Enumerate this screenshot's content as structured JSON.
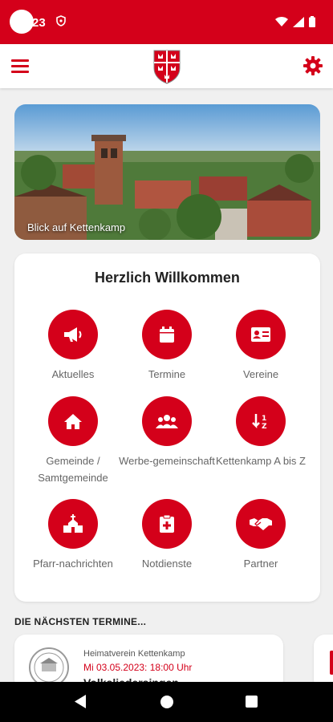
{
  "status_bar": {
    "time": "23",
    "shield_icon": "shield-icon",
    "icons": [
      "wifi-icon",
      "signal-icon",
      "battery-icon"
    ]
  },
  "app_bar": {
    "menu_icon": "menu-icon",
    "logo": "town-crest",
    "settings_icon": "gear-icon"
  },
  "hero": {
    "caption": "Blick auf Kettenkamp"
  },
  "welcome": {
    "title": "Herzlich Willkommen",
    "tiles": [
      {
        "label": "Aktuelles",
        "icon": "megaphone-icon"
      },
      {
        "label": "Termine",
        "icon": "calendar-icon"
      },
      {
        "label": "Vereine",
        "icon": "id-card-icon"
      },
      {
        "label": "Gemeinde / Samtgemeinde",
        "icon": "home-icon"
      },
      {
        "label": "Werbe-gemeinschaft",
        "icon": "group-icon"
      },
      {
        "label": "Kettenkamp A bis Z",
        "icon": "sort-icon"
      },
      {
        "label": "Pfarr-nachrichten",
        "icon": "church-icon"
      },
      {
        "label": "Notdienste",
        "icon": "medical-icon"
      },
      {
        "label": "Partner",
        "icon": "handshake-icon"
      }
    ]
  },
  "events": {
    "section_title": "DIE NÄCHSTEN TERMINE...",
    "items": [
      {
        "organizer": "Heimatverein Kettenkamp",
        "date": "Mi 03.05.2023: 18:00 Uhr",
        "title": "Volksliedersingen"
      }
    ]
  },
  "colors": {
    "accent": "#d4001a",
    "background": "#f0f0f0"
  },
  "nav_bar": {
    "icons": [
      "back-icon",
      "home-icon",
      "recents-icon"
    ]
  }
}
